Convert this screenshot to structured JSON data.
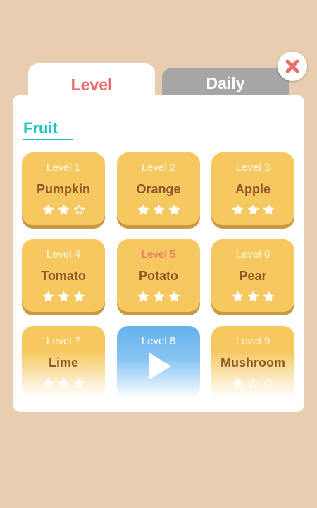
{
  "tabs": {
    "level": "Level",
    "daily": "Daily"
  },
  "section": {
    "title": "Fruit"
  },
  "colors": {
    "background": "#e9cdb1",
    "card": "#f6c860",
    "card_text": "#8c5a2a",
    "level_tab_text": "#ee6b6b",
    "section_title": "#1fc5c5",
    "play_card": "#64b2ee",
    "close_icon": "#ee6b6b"
  },
  "levels": [
    {
      "level": "Level 1",
      "name": "Pumpkin",
      "stars": 2,
      "max_stars": 3,
      "state": "completed"
    },
    {
      "level": "Level 2",
      "name": "Orange",
      "stars": 3,
      "max_stars": 3,
      "state": "completed"
    },
    {
      "level": "Level 3",
      "name": "Apple",
      "stars": 3,
      "max_stars": 3,
      "state": "completed"
    },
    {
      "level": "Level 4",
      "name": "Tomato",
      "stars": 3,
      "max_stars": 3,
      "state": "completed"
    },
    {
      "level": "Level 5",
      "name": "Potato",
      "stars": 3,
      "max_stars": 3,
      "state": "current"
    },
    {
      "level": "Level 6",
      "name": "Pear",
      "stars": 3,
      "max_stars": 3,
      "state": "completed"
    },
    {
      "level": "Level 7",
      "name": "Lime",
      "stars": 3,
      "max_stars": 3,
      "state": "completed"
    },
    {
      "level": "Level 8",
      "name": "",
      "stars": 0,
      "max_stars": 3,
      "state": "play",
      "icon": "play-icon"
    },
    {
      "level": "Level 9",
      "name": "Mushroom",
      "stars": 1,
      "max_stars": 3,
      "state": "completed"
    }
  ]
}
